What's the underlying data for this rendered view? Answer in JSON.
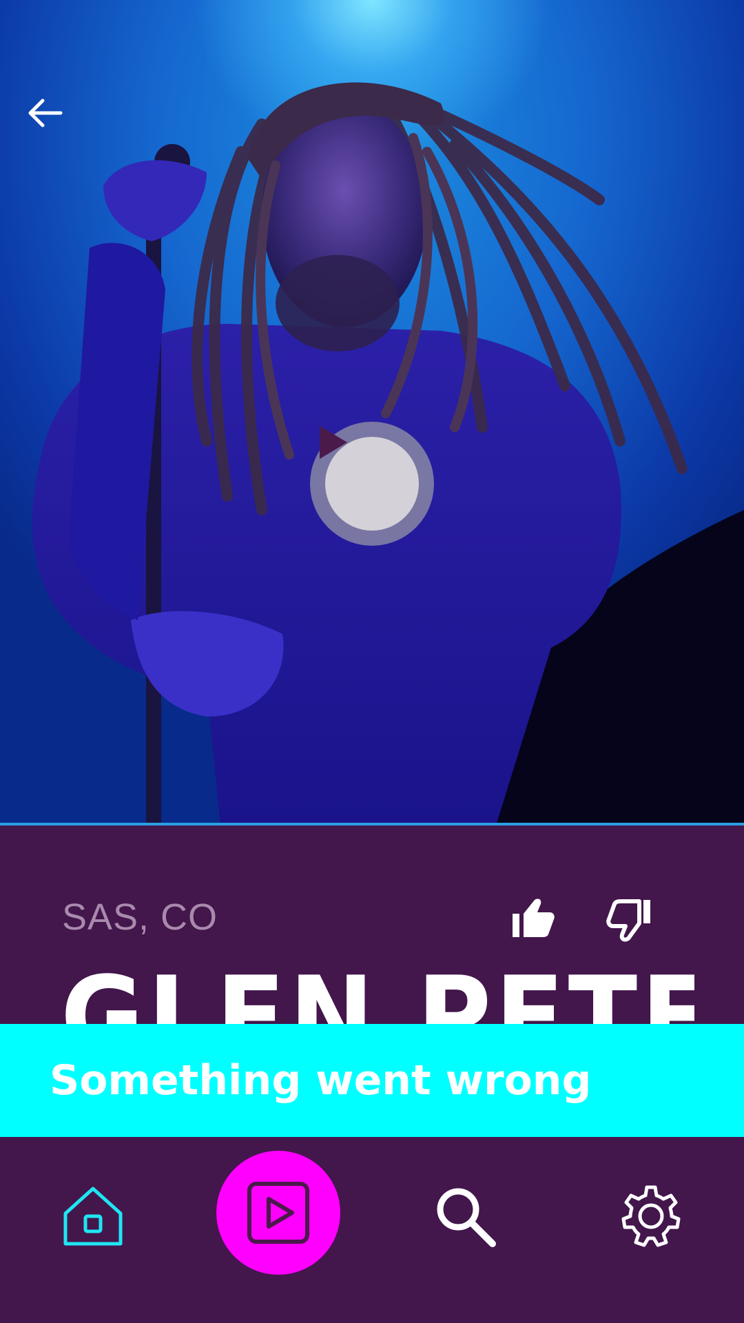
{
  "hero": {
    "image_description_icon": "singer-with-dreadlocks-photo"
  },
  "header": {
    "back_icon": "arrow-left-icon"
  },
  "player": {
    "overlay_icon": "play-icon"
  },
  "artist": {
    "location": "SAS, CO",
    "name": "GLEN PETERS"
  },
  "actions": {
    "like_icon": "thumbs-up-icon",
    "dislike_icon": "thumbs-down-icon"
  },
  "snackbar": {
    "message": "Something went wrong",
    "background": "#00ffff"
  },
  "nav": {
    "items": [
      {
        "icon": "home-icon",
        "active": true,
        "color": "#1ee6f2"
      },
      {
        "icon": "video-play-icon",
        "active": false,
        "color": "#ff00ff"
      },
      {
        "icon": "search-icon",
        "active": false,
        "color": "#ffffff"
      },
      {
        "icon": "settings-icon",
        "active": false,
        "color": "#ffffff"
      }
    ]
  },
  "colors": {
    "background": "#43164c",
    "accent": "#ff00ff",
    "hero_blue": "#1567cf",
    "location_text": "#a98aad"
  }
}
